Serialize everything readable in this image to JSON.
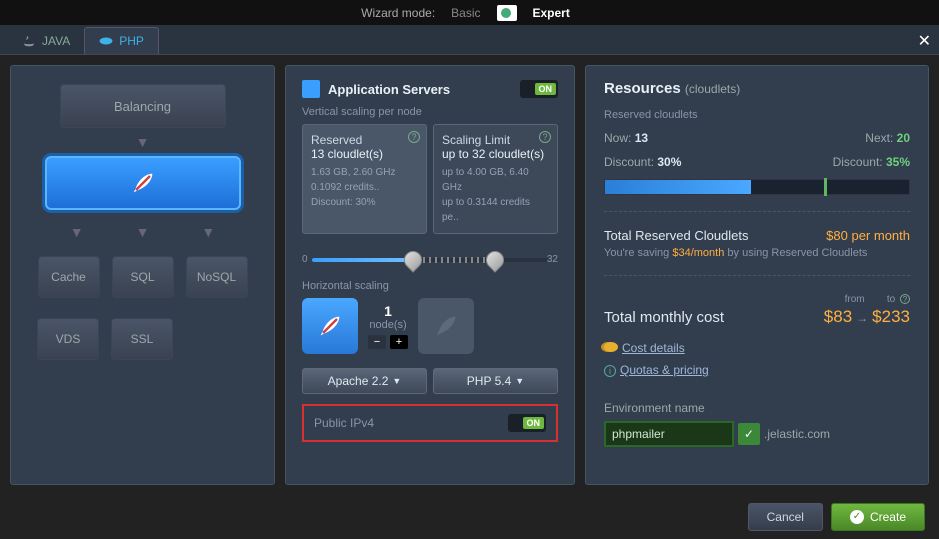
{
  "wizard": {
    "label": "Wizard mode:",
    "basic": "Basic",
    "expert": "Expert"
  },
  "tabs": {
    "java": "JAVA",
    "php": "PHP"
  },
  "topology": {
    "balancing": "Balancing",
    "cache": "Cache",
    "sql": "SQL",
    "nosql": "NoSQL",
    "vds": "VDS",
    "ssl": "SSL"
  },
  "appservers": {
    "title": "Application Servers",
    "on": "ON",
    "vertical_label": "Vertical scaling per node",
    "reserved": {
      "title": "Reserved",
      "value": "13 cloudlet(s)",
      "line1": "1.63 GB, 2.60 GHz",
      "line2": "0.1092 credits..",
      "discount": "Discount: 30%"
    },
    "limit": {
      "title": "Scaling Limit",
      "value": "up to 32 cloudlet(s)",
      "line1": "up to 4.00 GB, 6.40 GHz",
      "line2": "up to 0.3144 credits pe.."
    },
    "slider": {
      "min": "0",
      "max": "32"
    },
    "horizontal_label": "Horizontal scaling",
    "nodes": {
      "count": "1",
      "label": "node(s)"
    },
    "server_select": "Apache 2.2",
    "php_select": "PHP 5.4",
    "ipv4": {
      "label": "Public IPv4",
      "on": "ON"
    }
  },
  "resources": {
    "title": "Resources",
    "sub": "(cloudlets)",
    "reserved_label": "Reserved cloudlets",
    "now_k": "Now:",
    "now_v": "13",
    "next_k": "Next:",
    "next_v": "20",
    "disc_k": "Discount:",
    "disc_now": "30%",
    "disc_next": "35%",
    "trc_label": "Total Reserved Cloudlets",
    "trc_price": "$80 per month",
    "saving_pre": "You're saving ",
    "saving_amt": "$34/month",
    "saving_post": " by using Reserved Cloudlets",
    "from": "from",
    "to": "to",
    "tmc_label": "Total monthly cost",
    "tmc_from": "$83",
    "tmc_to": "$233",
    "cost_details": "Cost details",
    "quotas": "Quotas & pricing",
    "env_label": "Environment name",
    "env_value": "phpmailer",
    "env_domain": ".jelastic.com"
  },
  "footer": {
    "cancel": "Cancel",
    "create": "Create"
  }
}
